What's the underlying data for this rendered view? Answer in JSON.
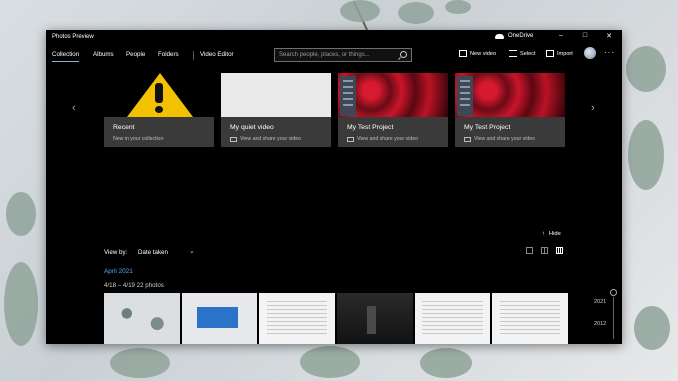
{
  "window": {
    "title": "Photos Preview"
  },
  "titlebar": {
    "onedrive_label": "OneDrive",
    "minimize": "–",
    "maximize": "□",
    "close": "✕"
  },
  "nav": {
    "tabs": [
      "Collection",
      "Albums",
      "People",
      "Folders"
    ],
    "video_editor": "Video Editor",
    "search_placeholder": "Search people, places, or things...",
    "new_video": "New video",
    "select": "Select",
    "import": "Import",
    "more": "···"
  },
  "carousel": {
    "prev": "‹",
    "next": "›",
    "cards": [
      {
        "title": "Recent",
        "subtitle": "New in your collection"
      },
      {
        "title": "My quiet video",
        "subtitle": "View and share your video"
      },
      {
        "title": "My Test Project",
        "subtitle": "View and share your video"
      },
      {
        "title": "My Test Project",
        "subtitle": "View and share your video"
      }
    ]
  },
  "hide": {
    "arrow": "↑",
    "label": "Hide"
  },
  "viewby": {
    "label": "View by:",
    "value": "Date taken",
    "chevron": "⌄"
  },
  "gallery": {
    "month": "April 2021",
    "range": "4/18 – 4/19    22 photos",
    "photos": [
      "leaves",
      "blue",
      "doc",
      "dark",
      "doc",
      "doc"
    ]
  },
  "timeline": {
    "years": [
      "2021",
      "2012"
    ]
  },
  "colors": {
    "accent": "#5aa9ff",
    "window_bg": "#000000",
    "caption_bg": "#3a3a3a"
  }
}
